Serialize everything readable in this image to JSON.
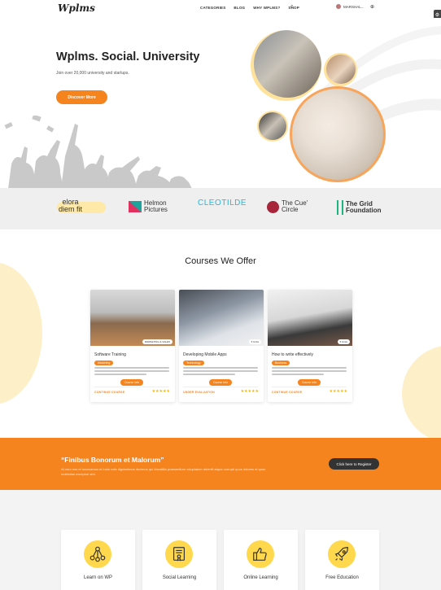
{
  "header": {
    "logo": "Wplms",
    "nav": [
      "CATEGORIES",
      "BLOG",
      "WHY WPLMS?",
      "SHOP"
    ],
    "user_name": "MARSHAL...",
    "icons": [
      "search-icon",
      "user-avatar",
      "cart-icon",
      "settings-icon"
    ]
  },
  "hero": {
    "title": "Wplms. Social. University",
    "subtitle": "Join over 20,000 university and startups.",
    "button": "Discover More"
  },
  "partners": [
    {
      "line1": "elora",
      "line2": "diem fit"
    },
    {
      "line1": "Helmon",
      "line2": "Pictures"
    },
    {
      "line1": "CLEOTILDE",
      "line2": ""
    },
    {
      "line1": "The Cue'",
      "line2": "Circle"
    },
    {
      "line1": "The Grid",
      "line2": "Foundation"
    }
  ],
  "courses": {
    "title": "Courses We Offer",
    "items": [
      {
        "title": "Software Training",
        "tag": "Marketing",
        "badge": "MARKETING & SALES",
        "button": "Course Info",
        "status": "CONTINUE COURSE",
        "rating": "★★★★★"
      },
      {
        "title": "Developing Mobile Apps",
        "tag": "Technology",
        "badge": "5 Units",
        "button": "Course Info",
        "status": "UNDER EVALUATION",
        "rating": "★★★★★"
      },
      {
        "title": "How to write effectively",
        "tag": "Business",
        "badge": "5 Units",
        "button": "Course Info",
        "status": "CONTINUE COURSE",
        "rating": "★★★★★"
      }
    ]
  },
  "cta": {
    "title": "“Finibus Bonorum et Malorum”",
    "text": "At vero eos et accusamus et iusto odio dignissimos ducimus qui blanditiis praesentium voluptatum deleniti atque corrupti quos dolores et quas molestias excepturi sint.",
    "button": "Click here to Register"
  },
  "features": [
    {
      "label": "Learn on WP",
      "icon": "wordpress-network-icon"
    },
    {
      "label": "Social Learning",
      "icon": "certificate-icon"
    },
    {
      "label": "Online Learning",
      "icon": "thumbs-up-icon"
    },
    {
      "label": "Free Education",
      "icon": "rocket-icon"
    }
  ],
  "colors": {
    "accent": "#f5841f",
    "soft_yellow": "#fdf0c9",
    "icon_yellow": "#ffd84d"
  }
}
